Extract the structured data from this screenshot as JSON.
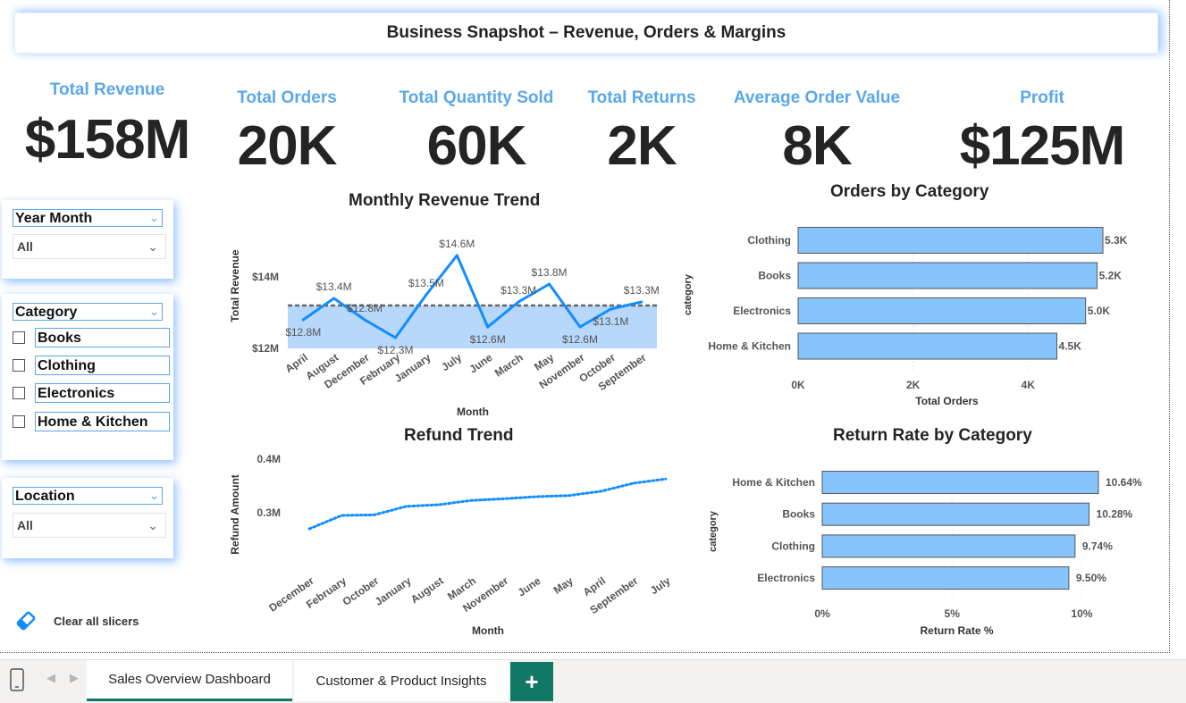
{
  "title": "Business Snapshot – Revenue, Orders & Margins",
  "kpis": [
    {
      "label": "Total Revenue",
      "value": "$158M"
    },
    {
      "label": "Total Orders",
      "value": "20K"
    },
    {
      "label": "Total Quantity Sold",
      "value": "60K"
    },
    {
      "label": "Total Returns",
      "value": "2K"
    },
    {
      "label": "Average Order Value",
      "value": "8K"
    },
    {
      "label": "Profit",
      "value": "$125M"
    }
  ],
  "slicers": {
    "year_month": {
      "header": "Year Month",
      "selected": "All"
    },
    "category": {
      "header": "Category",
      "options": [
        "Books",
        "Clothing",
        "Electronics",
        "Home & Kitchen"
      ]
    },
    "location": {
      "header": "Location",
      "selected": "All"
    },
    "clear_label": "Clear all slicers"
  },
  "tabs": {
    "items": [
      "Sales Overview Dashboard",
      "Customer & Product Insights"
    ],
    "active": 0,
    "add_label": "+"
  },
  "chart_data": [
    {
      "id": "monthly_revenue",
      "type": "line",
      "title": "Monthly Revenue Trend",
      "xlabel": "Month",
      "ylabel": "Total Revenue",
      "categories": [
        "April",
        "August",
        "December",
        "February",
        "January",
        "July",
        "June",
        "March",
        "May",
        "November",
        "October",
        "September"
      ],
      "values": [
        12.8,
        13.4,
        12.8,
        12.3,
        13.5,
        14.6,
        12.6,
        13.3,
        13.8,
        12.6,
        13.1,
        13.3
      ],
      "data_labels": [
        "$12.8M",
        "$13.4M",
        "$12.8M",
        "$12.3M",
        "$13.5M",
        "$14.6M",
        "$12.6M",
        "$13.3M",
        "$13.8M",
        "$12.6M",
        "$13.1M",
        "$13.3M"
      ],
      "yticks": [
        12,
        14
      ],
      "ytick_labels": [
        "$12M",
        "$14M"
      ],
      "ylim": [
        12,
        15
      ],
      "reference_line": 13.2,
      "color": "#118dff",
      "band_color": "#b7d7fb"
    },
    {
      "id": "orders_by_category",
      "type": "bar",
      "orientation": "horizontal",
      "title": "Orders by Category",
      "xlabel": "Total Orders",
      "ylabel": "category",
      "categories": [
        "Clothing",
        "Books",
        "Electronics",
        "Home & Kitchen"
      ],
      "values": [
        5300,
        5200,
        5000,
        4500
      ],
      "data_labels": [
        "5.3K",
        "5.2K",
        "5.0K",
        "4.5K"
      ],
      "xticks": [
        0,
        2000,
        4000
      ],
      "xtick_labels": [
        "0K",
        "2K",
        "4K"
      ],
      "xlim": [
        0,
        5300
      ],
      "color": "#86c4fb"
    },
    {
      "id": "refund_trend",
      "type": "line",
      "style": "dotted",
      "title": "Refund Trend",
      "xlabel": "Month",
      "ylabel": "Refund Amount",
      "categories": [
        "December",
        "February",
        "October",
        "January",
        "August",
        "March",
        "November",
        "June",
        "May",
        "April",
        "September",
        "July"
      ],
      "values": [
        0.27,
        0.295,
        0.296,
        0.312,
        0.315,
        0.323,
        0.326,
        0.33,
        0.332,
        0.34,
        0.355,
        0.363
      ],
      "yticks": [
        0.3,
        0.4
      ],
      "ytick_labels": [
        "0.3M",
        "0.4M"
      ],
      "ylim": [
        0.2,
        0.4
      ],
      "color": "#118dff"
    },
    {
      "id": "return_rate_by_category",
      "type": "bar",
      "orientation": "horizontal",
      "title": "Return Rate by Category",
      "xlabel": "Return Rate %",
      "ylabel": "category",
      "categories": [
        "Home & Kitchen",
        "Books",
        "Clothing",
        "Electronics"
      ],
      "values": [
        10.64,
        10.28,
        9.74,
        9.5
      ],
      "data_labels": [
        "10.64%",
        "10.28%",
        "9.74%",
        "9.50%"
      ],
      "xticks": [
        0,
        5,
        10
      ],
      "xtick_labels": [
        "0%",
        "5%",
        "10%"
      ],
      "xlim": [
        0,
        10.64
      ],
      "color": "#86c4fb"
    }
  ]
}
